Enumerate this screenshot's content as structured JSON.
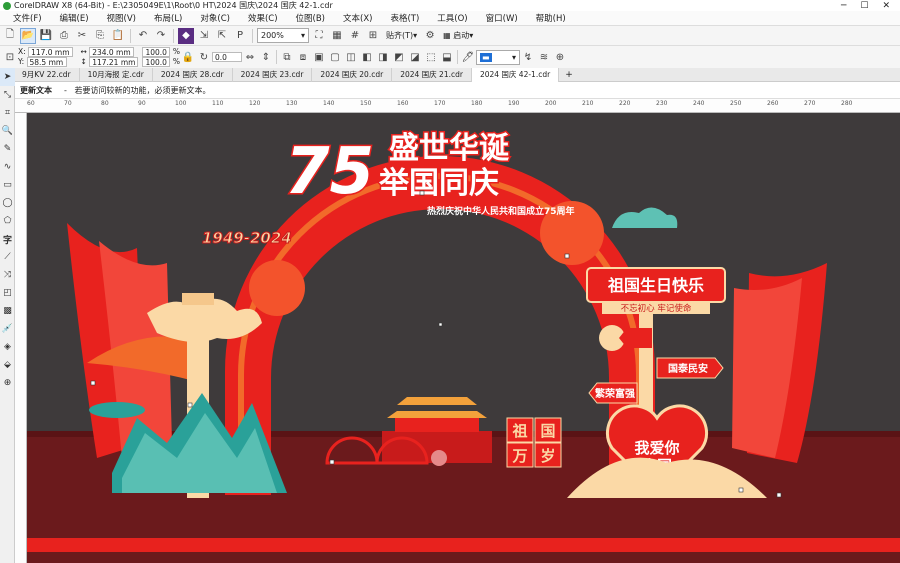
{
  "window": {
    "title": "CorelDRAW X8 (64-Bit) - E:\\2305049E\\1\\Root\\0 HT\\2024 国庆\\2024 国庆 42-1.cdr"
  },
  "menu": [
    "文件(F)",
    "编辑(E)",
    "视图(V)",
    "布局(L)",
    "对象(C)",
    "效果(C)",
    "位图(B)",
    "文本(X)",
    "表格(T)",
    "工具(O)",
    "窗口(W)",
    "帮助(H)"
  ],
  "toolbar": {
    "zoom": "200%",
    "snap": "贴齐(T)",
    "launch": "启动"
  },
  "properties": {
    "x": "117.0 mm",
    "y": "58.5 mm",
    "width": "234.0 mm",
    "height": "117.21 mm",
    "scale_x": "100.0",
    "scale_y": "100.0",
    "percent": "%",
    "angle": "0.0"
  },
  "tabs": [
    "9月KV 22.cdr",
    "10月海报 定.cdr",
    "2024 国庆 28.cdr",
    "2024 国庆 23.cdr",
    "2024 国庆 20.cdr",
    "2024 国庆 21.cdr",
    "2024 国庆 42-1.cdr"
  ],
  "hint": {
    "label": "更新文本",
    "text": "若要访问较新的功能，必须更新文本。"
  },
  "ruler": [
    "60",
    "70",
    "80",
    "90",
    "100",
    "110",
    "120",
    "130",
    "140",
    "150",
    "160",
    "170",
    "180",
    "190",
    "200",
    "210",
    "220",
    "230",
    "240",
    "250",
    "260",
    "270",
    "280"
  ],
  "artwork": {
    "num": "75",
    "line1": "盛世华诞",
    "line2": "举国同庆",
    "sub": "热烈庆祝中华人民共和国成立75周年",
    "years": "1949-2024",
    "sign_main": "祖国生日快乐",
    "sign_sub": "不忘初心 牢记使命",
    "arrow1": "国泰民安",
    "arrow2": "繁荣富强",
    "heart1": "我爱你",
    "heart2": "中国",
    "wish": [
      "祖",
      "国",
      "万",
      "岁"
    ]
  },
  "colors": {
    "red": "#e8221e",
    "orange": "#f26a2a",
    "cream": "#fbd9a6",
    "dark_bg": "#3e3a3b",
    "floor": "#6b1a1c"
  }
}
